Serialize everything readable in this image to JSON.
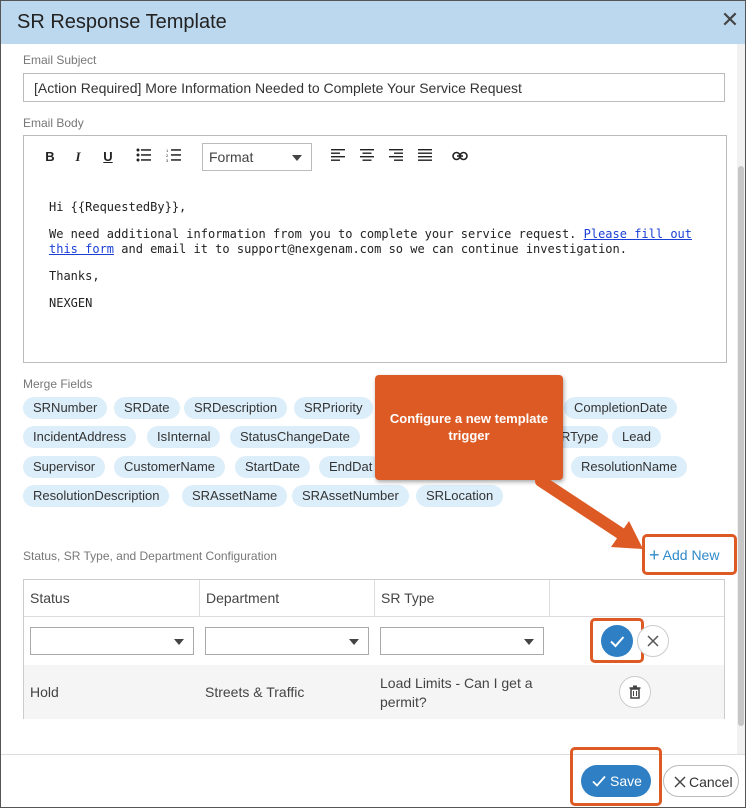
{
  "dialog": {
    "title": "SR Response Template",
    "close_icon": "close-icon"
  },
  "email_subject": {
    "label": "Email Subject",
    "value": "[Action Required] More Information Needed to Complete Your Service Request"
  },
  "email_body": {
    "label": "Email Body",
    "toolbar": {
      "bold": "B",
      "italic": "I",
      "underline": "U",
      "format_label": "Format"
    },
    "greeting": "Hi {{RequestedBy}},",
    "paragraph_before_link": "We need additional information from you to complete your service request. ",
    "link_text": "Please fill out this form",
    "paragraph_after_link": " and email it to support@nexgenam.com so we can continue investigation.",
    "closing": "Thanks,",
    "signature": "NEXGEN"
  },
  "merge_fields": {
    "label": "Merge Fields",
    "chips": [
      "SRNumber",
      "SRDate",
      "SRDescription",
      "SRPriority",
      "CompletionDate",
      "IncidentAddress",
      "IsInternal",
      "StatusChangeDate",
      "RType",
      "Lead",
      "Supervisor",
      "CustomerName",
      "StartDate",
      "EndDat",
      "ResolutionName",
      "ResolutionDescription",
      "SRAssetName",
      "SRAssetNumber",
      "SRLocation"
    ]
  },
  "callout": {
    "text": "Configure a new template trigger",
    "color": "#dd5a24"
  },
  "config": {
    "label": "Status, SR Type, and Department Configuration",
    "add_new": "Add New",
    "columns": [
      "Status",
      "Department",
      "SR Type"
    ],
    "rows": [
      {
        "status": "Hold",
        "department": "Streets & Traffic",
        "sr_type": "Load Limits - Can I get a permit?"
      }
    ]
  },
  "footer": {
    "save": "Save",
    "cancel": "Cancel"
  },
  "colors": {
    "titlebar": "#bcd8ee",
    "chip": "#dceefa",
    "primary": "#2e7fc4",
    "link": "#2e8bc9",
    "highlight": "#dd5a24"
  }
}
